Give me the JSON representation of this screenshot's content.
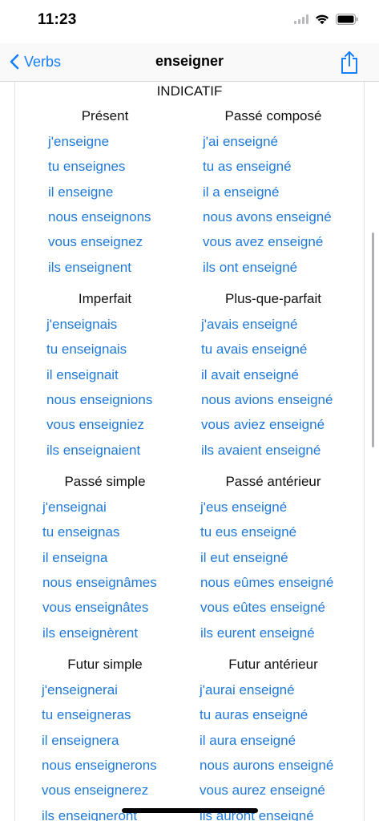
{
  "status": {
    "time": "11:23"
  },
  "nav": {
    "back_label": "Verbs",
    "title": "enseigner"
  },
  "mood": "INDICATIF",
  "tenses": [
    {
      "title": "Présent",
      "forms": [
        "j'enseigne",
        "tu enseignes",
        "il enseigne",
        "nous enseignons",
        "vous enseignez",
        "ils enseignent"
      ]
    },
    {
      "title": "Passé composé",
      "forms": [
        "j'ai enseigné",
        "tu as enseigné",
        "il a enseigné",
        "nous avons enseigné",
        "vous avez enseigné",
        "ils ont enseigné"
      ]
    },
    {
      "title": "Imperfait",
      "forms": [
        "j'enseignais",
        "tu enseignais",
        "il enseignait",
        "nous enseignions",
        "vous enseigniez",
        "ils enseignaient"
      ]
    },
    {
      "title": "Plus-que-parfait",
      "forms": [
        "j'avais enseigné",
        "tu avais enseigné",
        "il avait enseigné",
        "nous avions enseigné",
        "vous aviez enseigné",
        "ils avaient enseigné"
      ]
    },
    {
      "title": "Passé simple",
      "forms": [
        "j'enseignai",
        "tu enseignas",
        "il enseigna",
        "nous enseignâmes",
        "vous enseignâtes",
        "ils enseignèrent"
      ]
    },
    {
      "title": "Passé antérieur",
      "forms": [
        "j'eus enseigné",
        "tu eus enseigné",
        "il eut enseigné",
        "nous eûmes enseigné",
        "vous eûtes enseigné",
        "ils eurent enseigné"
      ]
    },
    {
      "title": "Futur simple",
      "forms": [
        "j'enseignerai",
        "tu enseigneras",
        "il enseignera",
        "nous enseignerons",
        "vous enseignerez",
        "ils enseigneront"
      ]
    },
    {
      "title": "Futur antérieur",
      "forms": [
        "j'aurai enseigné",
        "tu auras enseigné",
        "il aura enseigné",
        "nous aurons enseigné",
        "vous aurez enseigné",
        "ils auront enseigné"
      ]
    }
  ],
  "colors": {
    "link": "#1f79d9",
    "accent": "#157efb"
  },
  "icons": {
    "back": "chevron-left-icon",
    "share": "share-icon",
    "wifi": "wifi-icon",
    "battery": "battery-icon",
    "signal": "signal-icon"
  }
}
